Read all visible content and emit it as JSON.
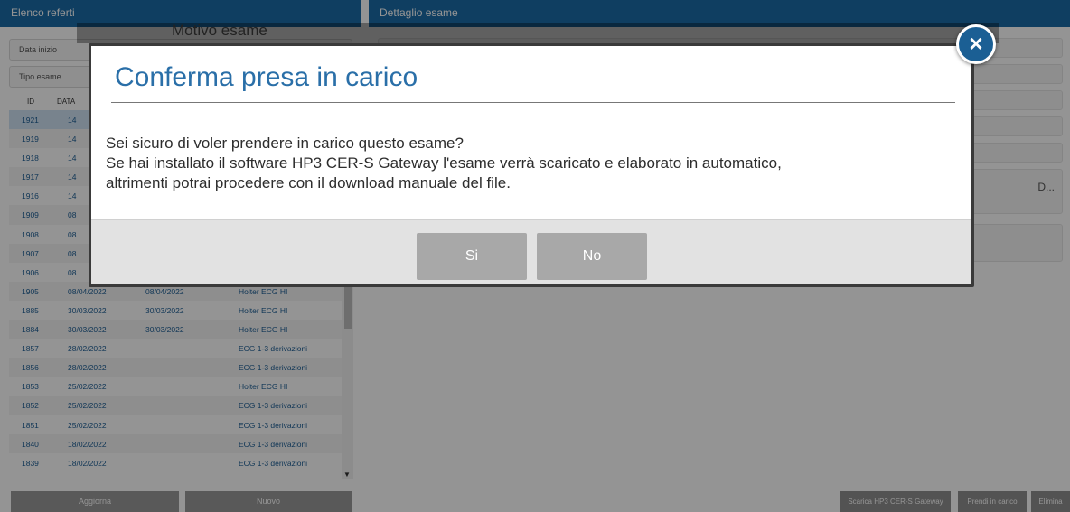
{
  "left_panel": {
    "title": "Elenco referti",
    "filters": [
      "Data inizio",
      "Tipo esame"
    ],
    "columns": [
      "ID",
      "DATA"
    ],
    "rows": [
      {
        "id": "1921",
        "d1": "14",
        "d2": "",
        "type": ""
      },
      {
        "id": "1919",
        "d1": "14",
        "d2": "",
        "type": ""
      },
      {
        "id": "1918",
        "d1": "14",
        "d2": "",
        "type": ""
      },
      {
        "id": "1917",
        "d1": "14",
        "d2": "",
        "type": ""
      },
      {
        "id": "1916",
        "d1": "14",
        "d2": "",
        "type": ""
      },
      {
        "id": "1909",
        "d1": "08",
        "d2": "",
        "type": ""
      },
      {
        "id": "1908",
        "d1": "08",
        "d2": "",
        "type": ""
      },
      {
        "id": "1907",
        "d1": "08",
        "d2": "",
        "type": ""
      },
      {
        "id": "1906",
        "d1": "08",
        "d2": "",
        "type": ""
      },
      {
        "id": "1905",
        "d1": "08/04/2022",
        "d2": "08/04/2022",
        "type": "Holter ECG HI"
      },
      {
        "id": "1885",
        "d1": "30/03/2022",
        "d2": "30/03/2022",
        "type": "Holter ECG HI"
      },
      {
        "id": "1884",
        "d1": "30/03/2022",
        "d2": "30/03/2022",
        "type": "Holter ECG HI"
      },
      {
        "id": "1857",
        "d1": "28/02/2022",
        "d2": "",
        "type": "ECG 1-3 derivazioni"
      },
      {
        "id": "1856",
        "d1": "28/02/2022",
        "d2": "",
        "type": "ECG 1-3 derivazioni"
      },
      {
        "id": "1853",
        "d1": "25/02/2022",
        "d2": "",
        "type": "Holter ECG HI"
      },
      {
        "id": "1852",
        "d1": "25/02/2022",
        "d2": "",
        "type": "ECG 1-3 derivazioni"
      },
      {
        "id": "1851",
        "d1": "25/02/2022",
        "d2": "",
        "type": "ECG 1-3 derivazioni"
      },
      {
        "id": "1840",
        "d1": "18/02/2022",
        "d2": "",
        "type": "ECG 1-3 derivazioni"
      },
      {
        "id": "1839",
        "d1": "18/02/2022",
        "d2": "",
        "type": "ECG 1-3 derivazioni"
      }
    ],
    "buttons": {
      "refresh": "Aggiorna",
      "new": "Nuovo"
    }
  },
  "right_panel": {
    "title": "Dettaglio esame",
    "hidden_label": "Motivo esame",
    "truncated_text": "D...",
    "buttons": {
      "download_gateway": "Scarica HP3 CER-S Gateway",
      "take_charge": "Prendi in carico",
      "delete": "Elimina"
    }
  },
  "modal": {
    "title": "Conferma presa in carico",
    "line1": "Sei sicuro di voler prendere in carico questo esame?",
    "line2": "Se hai installato il software HP3 CER-S Gateway l'esame verrà scaricato e elaborato in automatico,",
    "line3": "altrimenti potrai procedere con il download manuale del file.",
    "yes": "Si",
    "no": "No",
    "close_glyph": "×"
  },
  "colors": {
    "header": "#1b6ca8",
    "link": "#1d5e95",
    "modal_title": "#2a6fa8",
    "close": "#1b5f94"
  }
}
